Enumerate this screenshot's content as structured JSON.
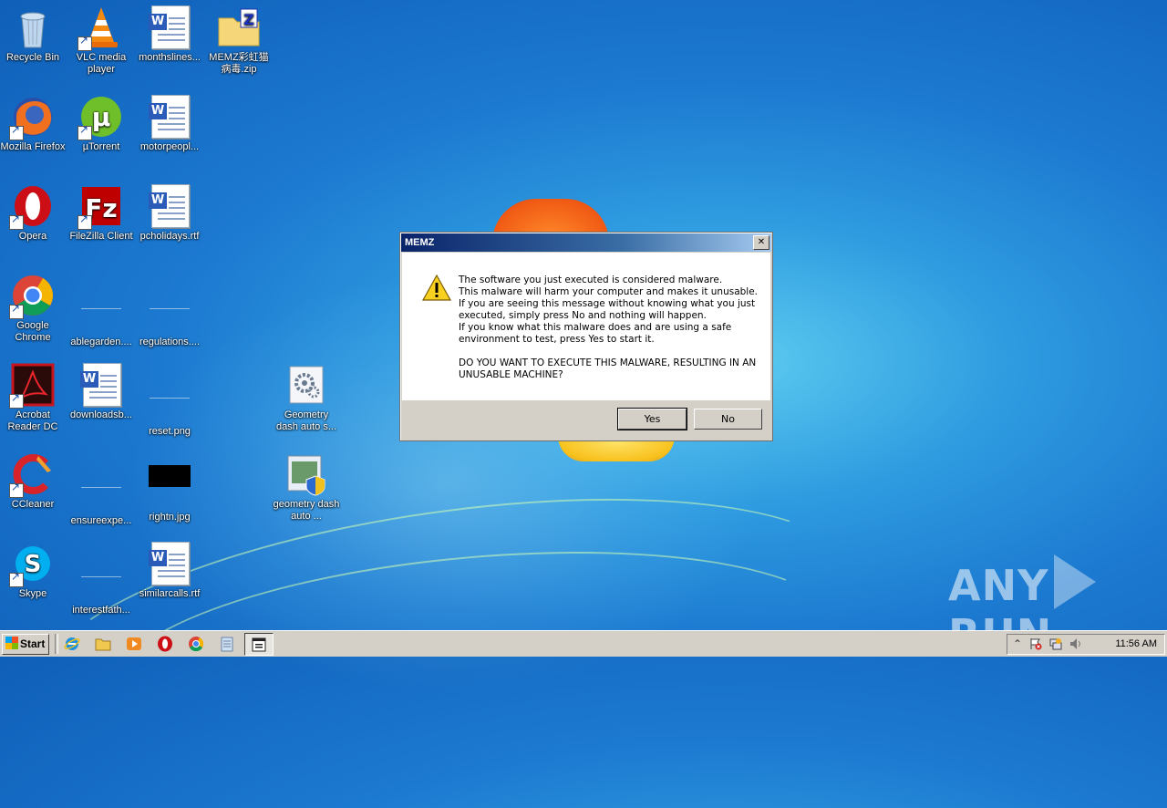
{
  "desktop": {
    "icons": [
      {
        "label": "Recycle Bin"
      },
      {
        "label": "VLC media player"
      },
      {
        "label": "monthslines..."
      },
      {
        "label": "MEMZ彩虹猫病毒.zip"
      },
      {
        "label": "Mozilla Firefox"
      },
      {
        "label": "µTorrent"
      },
      {
        "label": "motorpeopl..."
      },
      {
        "label": "Opera"
      },
      {
        "label": "FileZilla Client"
      },
      {
        "label": "pcholidays.rtf"
      },
      {
        "label": "Google Chrome"
      },
      {
        "label": "ablegarden...."
      },
      {
        "label": "regulations...."
      },
      {
        "label": "Acrobat Reader DC"
      },
      {
        "label": "downloadsb..."
      },
      {
        "label": "reset.png"
      },
      {
        "label": "Geometry dash auto s..."
      },
      {
        "label": "CCleaner"
      },
      {
        "label": "ensureexpe..."
      },
      {
        "label": "rightn.jpg"
      },
      {
        "label": "geometry dash auto ..."
      },
      {
        "label": "Skype"
      },
      {
        "label": "interestfath..."
      },
      {
        "label": "similarcalls.rtf"
      }
    ]
  },
  "dialog": {
    "title": "MEMZ",
    "close_glyph": "✕",
    "lines": [
      "The software you just executed is considered malware.",
      "This malware will harm your computer and makes it unusable.",
      "If you are seeing this message without knowing what you just executed, simply press No and nothing will happen.",
      "If you know what this malware does and are using a safe environment to test, press Yes to start it."
    ],
    "question": "DO YOU WANT TO EXECUTE THIS MALWARE, RESULTING IN AN UNUSABLE MACHINE?",
    "yes_label": "Yes",
    "no_label": "No"
  },
  "taskbar": {
    "start_label": "Start",
    "clock": "11:56 AM",
    "tray_expand_glyph": "⌃"
  },
  "watermark": {
    "left": "ANY",
    "right": "RUN"
  }
}
